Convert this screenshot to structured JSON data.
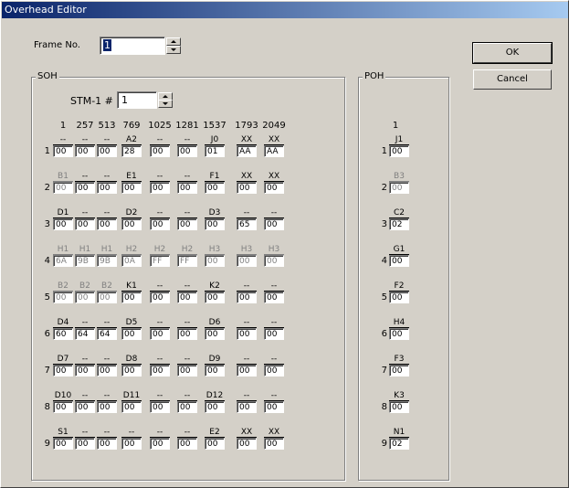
{
  "window": {
    "title": "Overhead Editor"
  },
  "frame": {
    "label": "Frame No.",
    "value": "1"
  },
  "buttons": {
    "ok": "OK",
    "cancel": "Cancel"
  },
  "soh": {
    "title": "SOH",
    "stm_label": "STM-1 #",
    "stm_value": "1",
    "columns": [
      "1",
      "257",
      "513",
      "769",
      "1025",
      "1281",
      "1537",
      "1793",
      "2049"
    ],
    "rows": [
      {
        "n": "1",
        "cells": [
          [
            "--",
            "00",
            0
          ],
          [
            "--",
            "00",
            0
          ],
          [
            "--",
            "00",
            0
          ],
          [
            "A2",
            "28",
            0
          ],
          [
            "--",
            "00",
            0
          ],
          [
            "--",
            "00",
            0
          ],
          [
            "J0",
            "01",
            0
          ],
          [
            "XX",
            "AA",
            0
          ],
          [
            "XX",
            "AA",
            0
          ]
        ]
      },
      {
        "n": "2",
        "cells": [
          [
            "B1",
            "00",
            1
          ],
          [
            "--",
            "00",
            0
          ],
          [
            "--",
            "00",
            0
          ],
          [
            "E1",
            "00",
            0
          ],
          [
            "--",
            "00",
            0
          ],
          [
            "--",
            "00",
            0
          ],
          [
            "F1",
            "00",
            0
          ],
          [
            "XX",
            "00",
            0
          ],
          [
            "XX",
            "00",
            0
          ]
        ]
      },
      {
        "n": "3",
        "cells": [
          [
            "D1",
            "00",
            0
          ],
          [
            "--",
            "00",
            0
          ],
          [
            "--",
            "00",
            0
          ],
          [
            "D2",
            "00",
            0
          ],
          [
            "--",
            "00",
            0
          ],
          [
            "--",
            "00",
            0
          ],
          [
            "D3",
            "00",
            0
          ],
          [
            "--",
            "65",
            0
          ],
          [
            "--",
            "00",
            0
          ]
        ]
      },
      {
        "n": "4",
        "cells": [
          [
            "H1",
            "6A",
            1
          ],
          [
            "H1",
            "9B",
            1
          ],
          [
            "H1",
            "9B",
            1
          ],
          [
            "H2",
            "0A",
            1
          ],
          [
            "H2",
            "FF",
            1
          ],
          [
            "H2",
            "FF",
            1
          ],
          [
            "H3",
            "00",
            1
          ],
          [
            "H3",
            "00",
            1
          ],
          [
            "H3",
            "00",
            1
          ]
        ]
      },
      {
        "n": "5",
        "cells": [
          [
            "B2",
            "00",
            1
          ],
          [
            "B2",
            "00",
            1
          ],
          [
            "B2",
            "00",
            1
          ],
          [
            "K1",
            "00",
            0
          ],
          [
            "--",
            "00",
            0
          ],
          [
            "--",
            "00",
            0
          ],
          [
            "K2",
            "00",
            0
          ],
          [
            "--",
            "00",
            0
          ],
          [
            "--",
            "00",
            0
          ]
        ]
      },
      {
        "n": "6",
        "cells": [
          [
            "D4",
            "60",
            0
          ],
          [
            "--",
            "64",
            0
          ],
          [
            "--",
            "64",
            0
          ],
          [
            "D5",
            "00",
            0
          ],
          [
            "--",
            "00",
            0
          ],
          [
            "--",
            "00",
            0
          ],
          [
            "D6",
            "00",
            0
          ],
          [
            "--",
            "00",
            0
          ],
          [
            "--",
            "00",
            0
          ]
        ]
      },
      {
        "n": "7",
        "cells": [
          [
            "D7",
            "00",
            0
          ],
          [
            "--",
            "00",
            0
          ],
          [
            "--",
            "00",
            0
          ],
          [
            "D8",
            "00",
            0
          ],
          [
            "--",
            "00",
            0
          ],
          [
            "--",
            "00",
            0
          ],
          [
            "D9",
            "00",
            0
          ],
          [
            "--",
            "00",
            0
          ],
          [
            "--",
            "00",
            0
          ]
        ]
      },
      {
        "n": "8",
        "cells": [
          [
            "D10",
            "00",
            0
          ],
          [
            "--",
            "00",
            0
          ],
          [
            "--",
            "00",
            0
          ],
          [
            "D11",
            "00",
            0
          ],
          [
            "--",
            "00",
            0
          ],
          [
            "--",
            "00",
            0
          ],
          [
            "D12",
            "00",
            0
          ],
          [
            "--",
            "00",
            0
          ],
          [
            "--",
            "00",
            0
          ]
        ]
      },
      {
        "n": "9",
        "cells": [
          [
            "S1",
            "00",
            0
          ],
          [
            "--",
            "00",
            0
          ],
          [
            "--",
            "00",
            0
          ],
          [
            "--",
            "00",
            0
          ],
          [
            "--",
            "00",
            0
          ],
          [
            "--",
            "00",
            0
          ],
          [
            "E2",
            "00",
            0
          ],
          [
            "XX",
            "00",
            0
          ],
          [
            "XX",
            "00",
            0
          ]
        ]
      }
    ]
  },
  "poh": {
    "title": "POH",
    "column": "1",
    "rows": [
      {
        "n": "1",
        "name": "J1",
        "value": "00",
        "dim": 0
      },
      {
        "n": "2",
        "name": "B3",
        "value": "00",
        "dim": 1
      },
      {
        "n": "3",
        "name": "C2",
        "value": "02",
        "dim": 0
      },
      {
        "n": "4",
        "name": "G1",
        "value": "00",
        "dim": 0
      },
      {
        "n": "5",
        "name": "F2",
        "value": "00",
        "dim": 0
      },
      {
        "n": "6",
        "name": "H4",
        "value": "00",
        "dim": 0
      },
      {
        "n": "7",
        "name": "F3",
        "value": "00",
        "dim": 0
      },
      {
        "n": "8",
        "name": "K3",
        "value": "00",
        "dim": 0
      },
      {
        "n": "9",
        "name": "N1",
        "value": "02",
        "dim": 0
      }
    ]
  }
}
